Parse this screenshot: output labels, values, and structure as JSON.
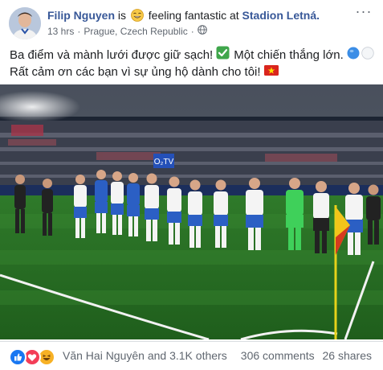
{
  "post": {
    "author": "Filip Nguyen",
    "is_text": "is",
    "feeling_text": "feeling fantastic at",
    "place": "Stadion Letná.",
    "time": "13 hrs",
    "separator": "·",
    "location": "Prague, Czech Republic",
    "separator2": "·",
    "more": "···",
    "text_line1": "Ba điểm và mành lưới được giữ sạch!",
    "text_line1b": "Một chiến thắng lớn.",
    "text_line2": "Rất cảm ơn các bạn vì sự ủng hộ dành cho tôi!"
  },
  "photo": {
    "board_text": "O₂TV"
  },
  "footer": {
    "reaction_names": "Văn Hai Nguyên and 3.1K others",
    "comments": "306 comments",
    "shares": "26 shares"
  },
  "colors": {
    "link": "#385898",
    "meta": "#606770",
    "like": "#1877f2",
    "love": "#f33e58",
    "haha": "#f7b125"
  },
  "icons": [
    "feeling-emoji-icon",
    "globe-icon",
    "check-icon",
    "blue-circle-icon",
    "white-circle-icon",
    "vietnam-flag-icon",
    "like-icon",
    "love-icon",
    "haha-icon"
  ]
}
